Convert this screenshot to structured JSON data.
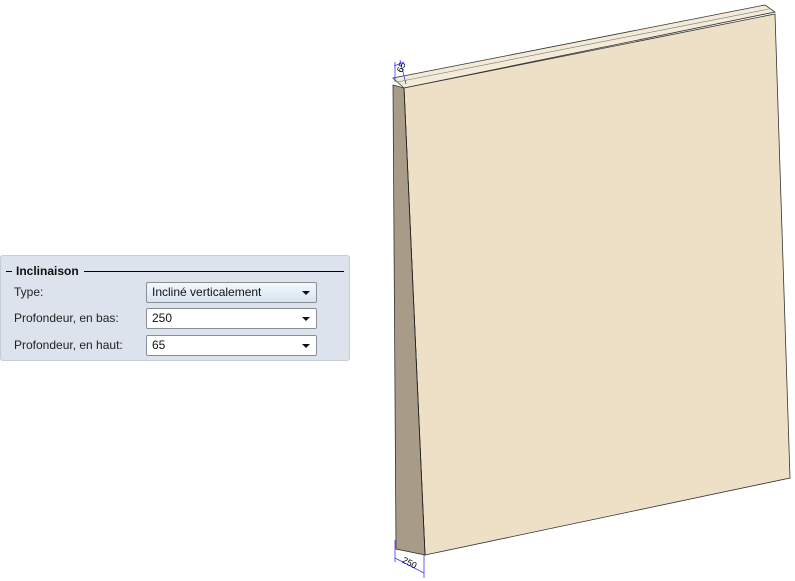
{
  "inclinaison": {
    "title": "Inclinaison",
    "type_label": "Type:",
    "type_value": "Incliné verticalement",
    "bottom_label": "Profondeur, en bas:",
    "bottom_value": "250",
    "top_label": "Profondeur, en haut:",
    "top_value": "65"
  },
  "model": {
    "dim_top": "65",
    "dim_bottom": "250",
    "face_color": "#eee0c6",
    "side_color": "#a89c88",
    "dim_color": "#3a3aff"
  }
}
